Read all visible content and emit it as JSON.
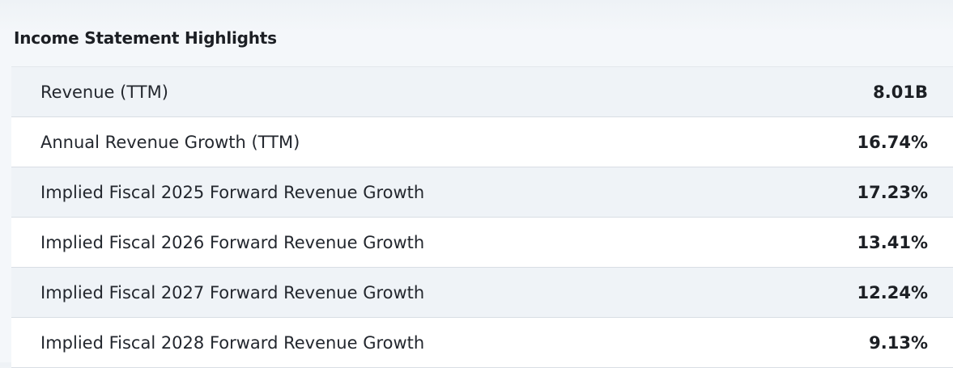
{
  "section": {
    "title": "Income Statement Highlights"
  },
  "rows": [
    {
      "label": "Revenue (TTM)",
      "value": "8.01B"
    },
    {
      "label": "Annual Revenue Growth (TTM)",
      "value": "16.74%"
    },
    {
      "label": "Implied Fiscal 2025 Forward Revenue Growth",
      "value": "17.23%"
    },
    {
      "label": "Implied Fiscal 2026 Forward Revenue Growth",
      "value": "13.41%"
    },
    {
      "label": "Implied Fiscal 2027 Forward Revenue Growth",
      "value": "12.24%"
    },
    {
      "label": "Implied Fiscal 2028 Forward Revenue Growth",
      "value": "9.13%"
    }
  ],
  "colors": {
    "shaded_row": "#eff3f7",
    "plain_row": "#ffffff",
    "divider": "#d9dee4",
    "text": "#1f2328"
  }
}
